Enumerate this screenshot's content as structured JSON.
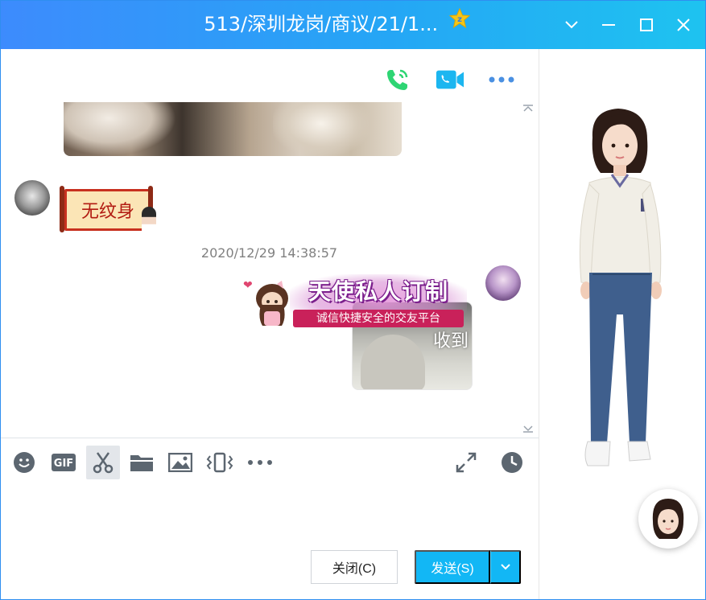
{
  "window": {
    "title": "513/深圳龙岗/商议/21/1...",
    "controls": [
      "chevron-down-icon",
      "minimize-icon",
      "maximize-icon",
      "close-icon"
    ]
  },
  "chat_header": {
    "icons": [
      "voice-call-icon",
      "video-call-icon",
      "more-icon"
    ]
  },
  "messages": [
    {
      "type": "image",
      "sender": "other",
      "description_icon": "photo-image"
    },
    {
      "type": "sticker",
      "sender": "other",
      "text": "无纹身"
    },
    {
      "type": "timestamp",
      "text": "2020/12/29 14:38:57"
    },
    {
      "type": "image",
      "sender": "self",
      "overlay_text": "收到"
    }
  ],
  "banner": {
    "title": "天使私人订制",
    "subtitle": "诚信快捷安全的交友平台"
  },
  "input_toolbar": {
    "tools": [
      "emoji-icon",
      "gif-icon",
      "screenshot-icon",
      "folder-icon",
      "image-icon",
      "shake-icon",
      "more-icon",
      "expand-icon",
      "history-icon"
    ]
  },
  "buttons": {
    "close_label": "关闭(C)",
    "send_label": "发送(S)"
  },
  "colors": {
    "titlebar_start": "#3d8bfd",
    "titlebar_end": "#1ec3f0",
    "send_button": "#12b7f5",
    "call_green": "#2ed573"
  }
}
